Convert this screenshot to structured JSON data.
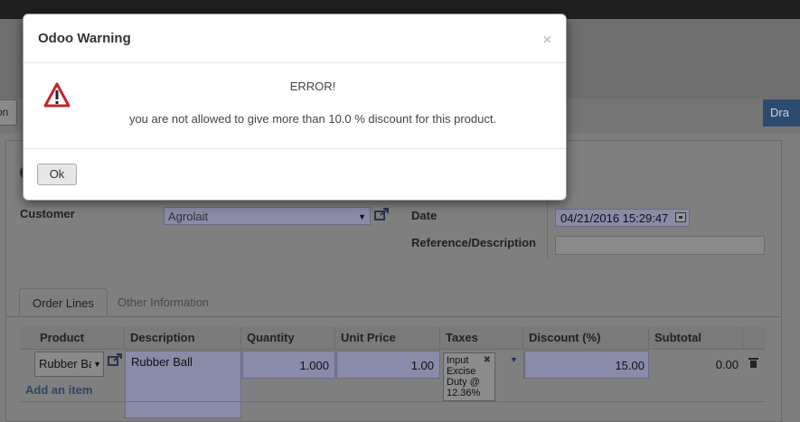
{
  "background_form": {
    "left_button_fragment": "on",
    "right_button_fragment": "Dra",
    "customer": {
      "label": "Customer",
      "value": "Agrolait"
    },
    "date": {
      "label": "Date",
      "value": "04/21/2016 15:29:47"
    },
    "reference": {
      "label": "Reference/Description",
      "value": ""
    },
    "tabs": [
      {
        "label": "Order Lines"
      },
      {
        "label": "Other Information"
      }
    ],
    "table": {
      "headers": [
        "Product",
        "Description",
        "Quantity",
        "Unit Price",
        "Taxes",
        "Discount (%)",
        "Subtotal"
      ],
      "row": {
        "product": "Rubber Ba",
        "description": "Rubber Ball",
        "quantity": "1.000",
        "unit_price": "1.00",
        "tax_tag": "Input Excise Duty @ 12.36%",
        "discount": "15.00",
        "subtotal": "0.00"
      },
      "add_item_label": "Add an item"
    }
  },
  "modal": {
    "title": "Odoo Warning",
    "close_glyph": "×",
    "error_title": "ERROR!",
    "error_message": "you are not allowed to give more than 10.0 % discount for this product.",
    "ok_label": "Ok"
  },
  "colors": {
    "overlay_gray": "#7d7d7d",
    "warning_red": "#c0262d",
    "link_blue": "#2f4666"
  },
  "icons": [
    "warning-icon",
    "close-icon",
    "external-link-icon",
    "calendar-icon",
    "dropdown-caret-icon",
    "trash-icon"
  ]
}
